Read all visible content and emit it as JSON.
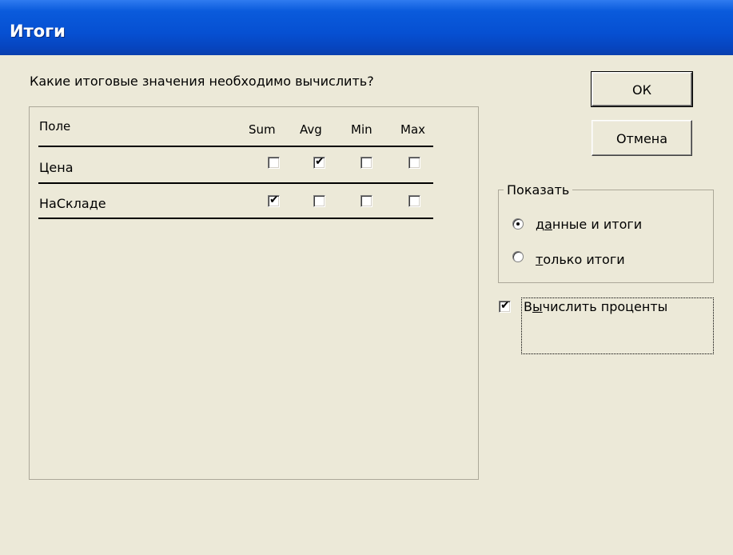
{
  "window": {
    "title": "Итоги"
  },
  "question": "Какие итоговые значения необходимо вычислить?",
  "table": {
    "field_header": "Поле",
    "columns": [
      "Sum",
      "Avg",
      "Min",
      "Max"
    ],
    "rows": [
      {
        "label": "Цена",
        "checks": [
          false,
          true,
          false,
          false
        ]
      },
      {
        "label": "НаСкладе",
        "checks": [
          true,
          false,
          false,
          false
        ]
      }
    ]
  },
  "buttons": {
    "ok": "ОК",
    "cancel": "Отмена"
  },
  "show_group": {
    "legend": "Показать",
    "options": [
      {
        "pre": "д",
        "accel": "а",
        "post": "нные и итоги",
        "selected": true
      },
      {
        "pre": "",
        "accel": "т",
        "post": "олько итоги",
        "selected": false
      }
    ]
  },
  "percent": {
    "pre": "В",
    "accel": "ы",
    "post": "числить проценты",
    "checked": true
  },
  "marks": {
    "check": "✔"
  }
}
